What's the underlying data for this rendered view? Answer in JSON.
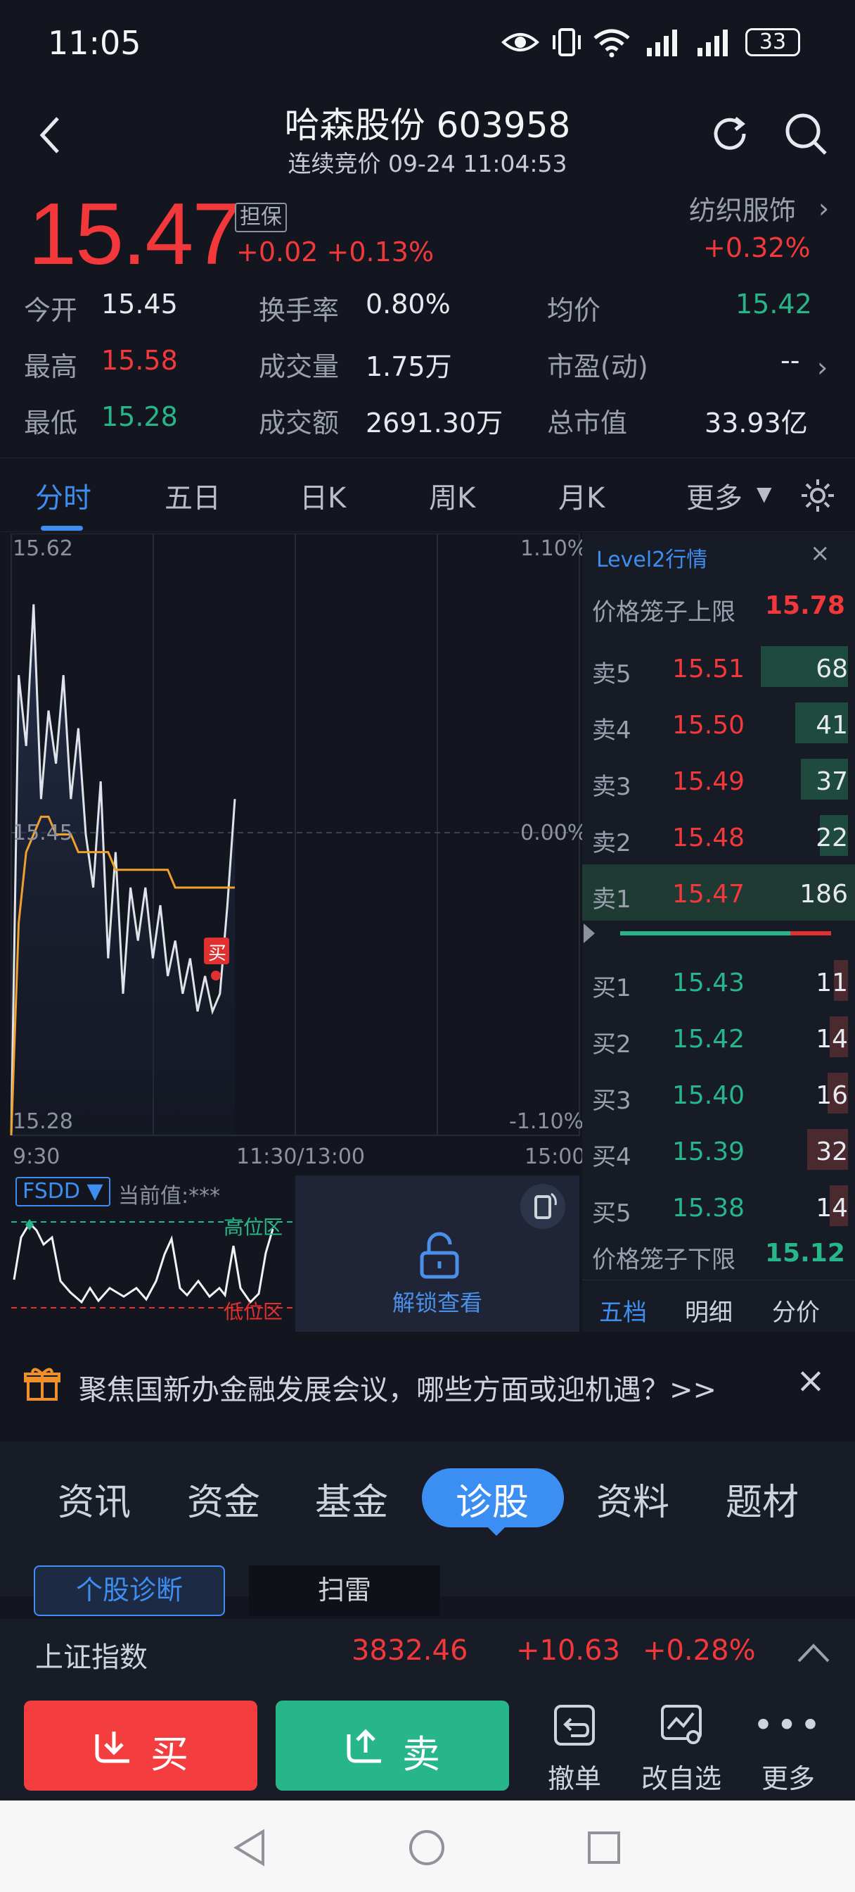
{
  "status": {
    "time": "11:05",
    "battery": "33"
  },
  "header": {
    "title": "哈森股份 603958",
    "subtitle": "连续竞价 09-24 11:04:53"
  },
  "quote": {
    "price": "15.47",
    "badge": "担保",
    "change": "+0.02 +0.13%",
    "sector": "纺织服饰",
    "sector_change": "+0.32%"
  },
  "stats": {
    "open_label": "今开",
    "open": "15.45",
    "high_label": "最高",
    "high": "15.58",
    "low_label": "最低",
    "low": "15.28",
    "turnover_label": "换手率",
    "turnover": "0.80%",
    "volume_label": "成交量",
    "volume": "1.75万",
    "amount_label": "成交额",
    "amount": "2691.30万",
    "avg_label": "均价",
    "avg": "15.42",
    "pe_label": "市盈(动)",
    "pe": "--",
    "mcap_label": "总市值",
    "mcap": "33.93亿"
  },
  "tabs": [
    "分时",
    "五日",
    "日K",
    "周K",
    "月K",
    "更多"
  ],
  "chart": {
    "y_top": "15.62",
    "y_mid": "15.45",
    "y_bottom": "15.28",
    "pct_top": "1.10%",
    "pct_mid": "0.00%",
    "pct_bottom": "-1.10%",
    "x_start": "9:30",
    "x_mid": "11:30/13:00",
    "x_end": "15:00",
    "buy_marker": "买"
  },
  "chart_data": {
    "type": "line",
    "series": [
      {
        "values": [
          15.28,
          15.54,
          15.5,
          15.58,
          15.47,
          15.52,
          15.49,
          15.54,
          15.47,
          15.51,
          15.45,
          15.42,
          15.48,
          15.38,
          15.44,
          15.36,
          15.42,
          15.39,
          15.42,
          15.38,
          15.41,
          15.37,
          15.39,
          15.36,
          15.38,
          15.35,
          15.37,
          15.35,
          15.36,
          15.41,
          15.47
        ]
      },
      {
        "values": [
          15.28,
          15.4,
          15.44,
          15.45,
          15.46,
          15.46,
          15.45,
          15.45,
          15.45,
          15.44,
          15.44,
          15.44,
          15.44,
          15.44,
          15.43,
          15.43,
          15.43,
          15.43,
          15.43,
          15.43,
          15.43,
          15.43,
          15.42,
          15.42,
          15.42,
          15.42,
          15.42,
          15.42,
          15.42,
          15.42,
          15.42
        ]
      }
    ],
    "ylim": [
      15.28,
      15.62
    ]
  },
  "indicator": {
    "name": "FSDD ▼",
    "current": "当前值:***",
    "high_zone": "高位区",
    "low_zone": "低位区",
    "unlock": "解锁查看"
  },
  "level2": {
    "title": "Level2行情",
    "upper_label": "价格笼子上限",
    "upper": "15.78",
    "lower_label": "价格笼子下限",
    "lower": "15.12",
    "asks": [
      {
        "label": "卖5",
        "price": "15.51",
        "vol": "68"
      },
      {
        "label": "卖4",
        "price": "15.50",
        "vol": "41"
      },
      {
        "label": "卖3",
        "price": "15.49",
        "vol": "37"
      },
      {
        "label": "卖2",
        "price": "15.48",
        "vol": "22"
      },
      {
        "label": "卖1",
        "price": "15.47",
        "vol": "186"
      }
    ],
    "bids": [
      {
        "label": "买1",
        "price": "15.43",
        "vol": "11"
      },
      {
        "label": "买2",
        "price": "15.42",
        "vol": "14"
      },
      {
        "label": "买3",
        "price": "15.40",
        "vol": "16"
      },
      {
        "label": "买4",
        "price": "15.39",
        "vol": "32"
      },
      {
        "label": "买5",
        "price": "15.38",
        "vol": "14"
      }
    ],
    "tabs": [
      "五档",
      "明细",
      "分价"
    ]
  },
  "notice": {
    "text": "聚焦国新办金融发展会议，哪些方面或迎机遇？>>"
  },
  "section_tabs": [
    "资讯",
    "资金",
    "基金",
    "诊股",
    "资料",
    "题材"
  ],
  "sub_tabs": [
    "个股诊断",
    "扫雷"
  ],
  "index": {
    "name": "上证指数",
    "value": "3832.46",
    "change": "+10.63",
    "pct": "+0.28%"
  },
  "actions": {
    "buy": "买",
    "sell": "卖",
    "cancel": "撤单",
    "edit": "改自选",
    "more": "更多"
  },
  "colors": {
    "up": "#f2383a",
    "down": "#27b58a",
    "accent": "#3d8ef0",
    "bg": "#13161f"
  }
}
